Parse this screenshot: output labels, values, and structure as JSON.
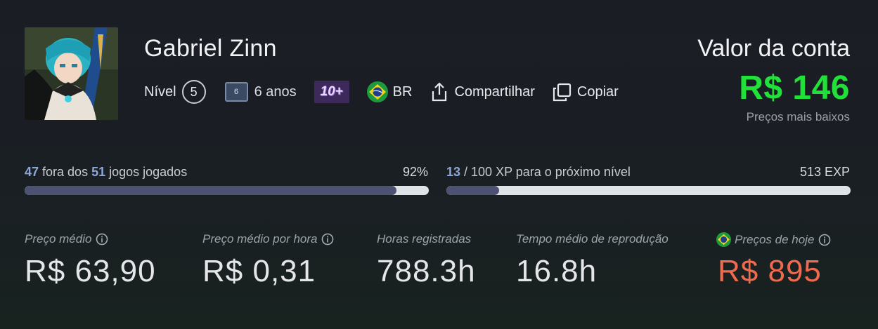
{
  "profile": {
    "name": "Gabriel Zinn",
    "level_label": "Nível",
    "level": "5",
    "years_badge": "6",
    "years_text": "6 anos",
    "games_badge": "10+",
    "country": "BR",
    "share_label": "Compartilhar",
    "copy_label": "Copiar"
  },
  "account_value": {
    "title": "Valor da conta",
    "amount": "R$ 146",
    "subtitle": "Preços mais baixos"
  },
  "games_progress": {
    "played": "47",
    "middle": " fora dos ",
    "total": "51",
    "suffix": " jogos jogados",
    "percent_label": "92%",
    "fill_fraction": 0.92
  },
  "xp_progress": {
    "current": "13",
    "suffix": " / 100 XP para o próximo nível",
    "total_exp": "513 EXP",
    "fill_fraction": 0.13
  },
  "stats": [
    {
      "label": "Preço médio",
      "value": "R$ 63,90"
    },
    {
      "label": "Preço médio por hora",
      "value": "R$ 0,31"
    },
    {
      "label": "Horas registradas",
      "value": "788.3h"
    },
    {
      "label": "Tempo médio de reprodução",
      "value": "16.8h"
    },
    {
      "label": "Preços de hoje",
      "value": "R$ 895"
    }
  ],
  "colors": {
    "accent_green": "#22e03a",
    "today_price_red": "#f06a4f",
    "bar_fill": "#4d5273",
    "bar_track": "#dfe2e7"
  },
  "icons": [
    "avatar",
    "level-circle",
    "years-badge-icon",
    "games-badge",
    "brazil-flag-icon",
    "share-icon",
    "copy-icon",
    "info-icon"
  ]
}
